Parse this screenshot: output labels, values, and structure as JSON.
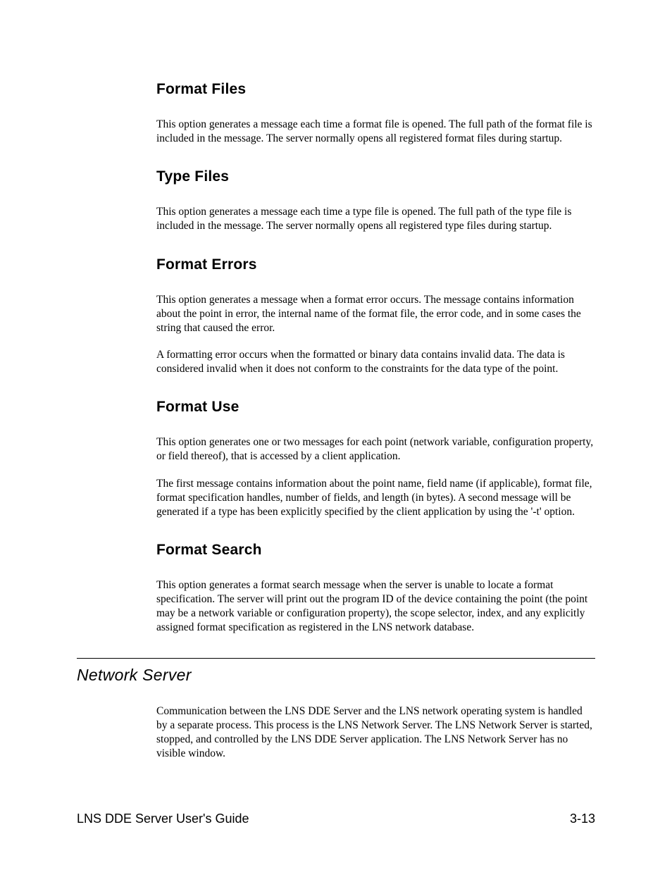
{
  "sections": {
    "format_files": {
      "heading": "Format Files",
      "p1": "This option generates a message each time a format file is opened. The full path of the format file is included in the message.  The server normally opens all registered format files during startup."
    },
    "type_files": {
      "heading": "Type Files",
      "p1": "This option generates a message each time a type file is opened. The full path of the type file is included in the message.  The server normally opens all registered type files during startup."
    },
    "format_errors": {
      "heading": "Format Errors",
      "p1": "This option generates a message when a format error occurs.  The message contains information about the point in error, the internal name of the format file, the error code, and in some cases the string that caused the error.",
      "p2": "A formatting error occurs when the formatted or binary data contains invalid data.  The data is considered invalid when it does not conform to the constraints for the data type of the point."
    },
    "format_use": {
      "heading": "Format Use",
      "p1": "This option generates one or two messages for each point (network variable, configuration property, or field thereof), that is accessed by a client application.",
      "p2": "The first message contains information about the point name, field name (if applicable), format file, format specification handles, number of fields, and length (in bytes).  A second message will be generated if a type has been explicitly specified by the client application by using the '-t' option."
    },
    "format_search": {
      "heading": "Format Search",
      "p1": "This option generates a format search message when the server is unable to locate a format specification.  The server will print out the program ID of the device containing the point (the point may be a network variable or configuration property), the scope selector, index, and any explicitly assigned format specification as registered in the LNS network database."
    },
    "network_server": {
      "heading": "Network Server",
      "p1": "Communication between the LNS DDE Server and the LNS network operating system is handled by a separate process.  This process is the LNS Network Server.  The LNS Network Server is started, stopped, and controlled by the LNS DDE Server application.  The LNS Network Server has no visible window."
    }
  },
  "footer": {
    "left": "LNS DDE Server User's Guide",
    "right": "3-13"
  }
}
